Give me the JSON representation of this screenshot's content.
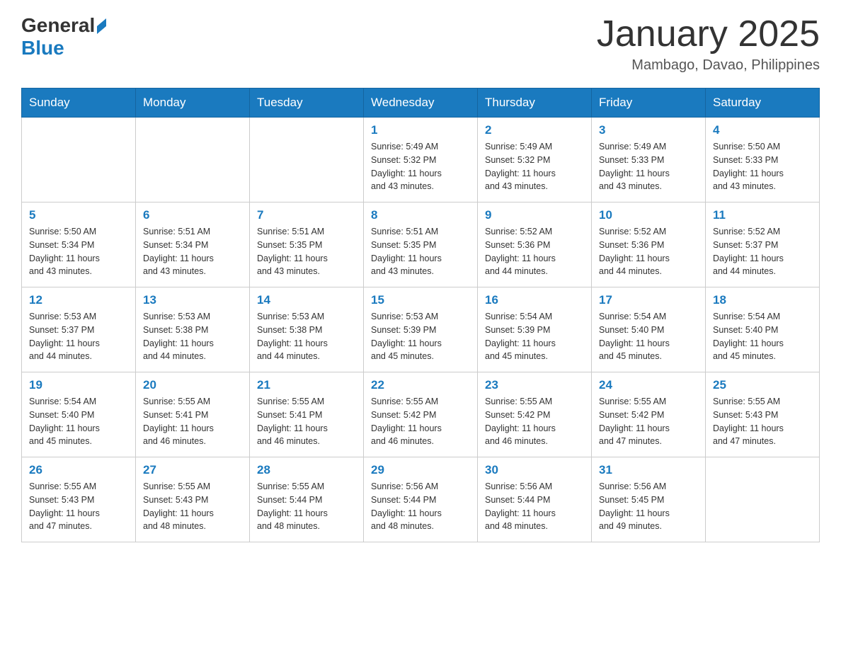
{
  "header": {
    "logo_general": "General",
    "logo_blue": "Blue",
    "month_title": "January 2025",
    "location": "Mambago, Davao, Philippines"
  },
  "weekdays": [
    "Sunday",
    "Monday",
    "Tuesday",
    "Wednesday",
    "Thursday",
    "Friday",
    "Saturday"
  ],
  "weeks": [
    [
      {
        "day": "",
        "info": ""
      },
      {
        "day": "",
        "info": ""
      },
      {
        "day": "",
        "info": ""
      },
      {
        "day": "1",
        "info": "Sunrise: 5:49 AM\nSunset: 5:32 PM\nDaylight: 11 hours\nand 43 minutes."
      },
      {
        "day": "2",
        "info": "Sunrise: 5:49 AM\nSunset: 5:32 PM\nDaylight: 11 hours\nand 43 minutes."
      },
      {
        "day": "3",
        "info": "Sunrise: 5:49 AM\nSunset: 5:33 PM\nDaylight: 11 hours\nand 43 minutes."
      },
      {
        "day": "4",
        "info": "Sunrise: 5:50 AM\nSunset: 5:33 PM\nDaylight: 11 hours\nand 43 minutes."
      }
    ],
    [
      {
        "day": "5",
        "info": "Sunrise: 5:50 AM\nSunset: 5:34 PM\nDaylight: 11 hours\nand 43 minutes."
      },
      {
        "day": "6",
        "info": "Sunrise: 5:51 AM\nSunset: 5:34 PM\nDaylight: 11 hours\nand 43 minutes."
      },
      {
        "day": "7",
        "info": "Sunrise: 5:51 AM\nSunset: 5:35 PM\nDaylight: 11 hours\nand 43 minutes."
      },
      {
        "day": "8",
        "info": "Sunrise: 5:51 AM\nSunset: 5:35 PM\nDaylight: 11 hours\nand 43 minutes."
      },
      {
        "day": "9",
        "info": "Sunrise: 5:52 AM\nSunset: 5:36 PM\nDaylight: 11 hours\nand 44 minutes."
      },
      {
        "day": "10",
        "info": "Sunrise: 5:52 AM\nSunset: 5:36 PM\nDaylight: 11 hours\nand 44 minutes."
      },
      {
        "day": "11",
        "info": "Sunrise: 5:52 AM\nSunset: 5:37 PM\nDaylight: 11 hours\nand 44 minutes."
      }
    ],
    [
      {
        "day": "12",
        "info": "Sunrise: 5:53 AM\nSunset: 5:37 PM\nDaylight: 11 hours\nand 44 minutes."
      },
      {
        "day": "13",
        "info": "Sunrise: 5:53 AM\nSunset: 5:38 PM\nDaylight: 11 hours\nand 44 minutes."
      },
      {
        "day": "14",
        "info": "Sunrise: 5:53 AM\nSunset: 5:38 PM\nDaylight: 11 hours\nand 44 minutes."
      },
      {
        "day": "15",
        "info": "Sunrise: 5:53 AM\nSunset: 5:39 PM\nDaylight: 11 hours\nand 45 minutes."
      },
      {
        "day": "16",
        "info": "Sunrise: 5:54 AM\nSunset: 5:39 PM\nDaylight: 11 hours\nand 45 minutes."
      },
      {
        "day": "17",
        "info": "Sunrise: 5:54 AM\nSunset: 5:40 PM\nDaylight: 11 hours\nand 45 minutes."
      },
      {
        "day": "18",
        "info": "Sunrise: 5:54 AM\nSunset: 5:40 PM\nDaylight: 11 hours\nand 45 minutes."
      }
    ],
    [
      {
        "day": "19",
        "info": "Sunrise: 5:54 AM\nSunset: 5:40 PM\nDaylight: 11 hours\nand 45 minutes."
      },
      {
        "day": "20",
        "info": "Sunrise: 5:55 AM\nSunset: 5:41 PM\nDaylight: 11 hours\nand 46 minutes."
      },
      {
        "day": "21",
        "info": "Sunrise: 5:55 AM\nSunset: 5:41 PM\nDaylight: 11 hours\nand 46 minutes."
      },
      {
        "day": "22",
        "info": "Sunrise: 5:55 AM\nSunset: 5:42 PM\nDaylight: 11 hours\nand 46 minutes."
      },
      {
        "day": "23",
        "info": "Sunrise: 5:55 AM\nSunset: 5:42 PM\nDaylight: 11 hours\nand 46 minutes."
      },
      {
        "day": "24",
        "info": "Sunrise: 5:55 AM\nSunset: 5:42 PM\nDaylight: 11 hours\nand 47 minutes."
      },
      {
        "day": "25",
        "info": "Sunrise: 5:55 AM\nSunset: 5:43 PM\nDaylight: 11 hours\nand 47 minutes."
      }
    ],
    [
      {
        "day": "26",
        "info": "Sunrise: 5:55 AM\nSunset: 5:43 PM\nDaylight: 11 hours\nand 47 minutes."
      },
      {
        "day": "27",
        "info": "Sunrise: 5:55 AM\nSunset: 5:43 PM\nDaylight: 11 hours\nand 48 minutes."
      },
      {
        "day": "28",
        "info": "Sunrise: 5:55 AM\nSunset: 5:44 PM\nDaylight: 11 hours\nand 48 minutes."
      },
      {
        "day": "29",
        "info": "Sunrise: 5:56 AM\nSunset: 5:44 PM\nDaylight: 11 hours\nand 48 minutes."
      },
      {
        "day": "30",
        "info": "Sunrise: 5:56 AM\nSunset: 5:44 PM\nDaylight: 11 hours\nand 48 minutes."
      },
      {
        "day": "31",
        "info": "Sunrise: 5:56 AM\nSunset: 5:45 PM\nDaylight: 11 hours\nand 49 minutes."
      },
      {
        "day": "",
        "info": ""
      }
    ]
  ]
}
